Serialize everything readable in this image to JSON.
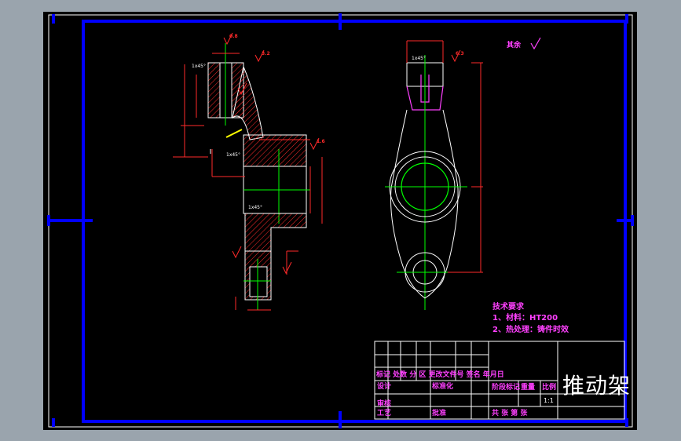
{
  "drawing": {
    "title": "推动架",
    "roughness_note": "其余",
    "tech_requirements": {
      "heading": "技术要求",
      "items": [
        "1、材料：HT200",
        "2、热处理：铸件时效"
      ]
    },
    "title_block": {
      "row_marks": "标记 处数 分 区 更改文件号 签名 年月日",
      "design": "设计",
      "standardization": "标准化",
      "stage_mark": "阶段标记",
      "weight": "重量",
      "scale_label": "比例",
      "scale_value": "1:1",
      "review": "审核",
      "process": "工艺",
      "approve": "批准",
      "sheets": "共  张 第  张"
    },
    "dim_labels": {
      "chamfer_1": "1x45°",
      "chamfer_2": "1x45°",
      "chamfer_3": "1x45°",
      "chamfer_4": "1x45°",
      "dim_a": "0.8",
      "dim_b": "3.2",
      "dim_c": "1.6",
      "dim_d": "6.3"
    }
  },
  "colors": {
    "frame": "#0000ff",
    "outline": "#ffffff",
    "dimension": "#ff2a2a",
    "centerline": "#00ff00",
    "hatch": "#ff2a2a",
    "highlight": "#ff40ff",
    "yellow": "#ffff00"
  }
}
